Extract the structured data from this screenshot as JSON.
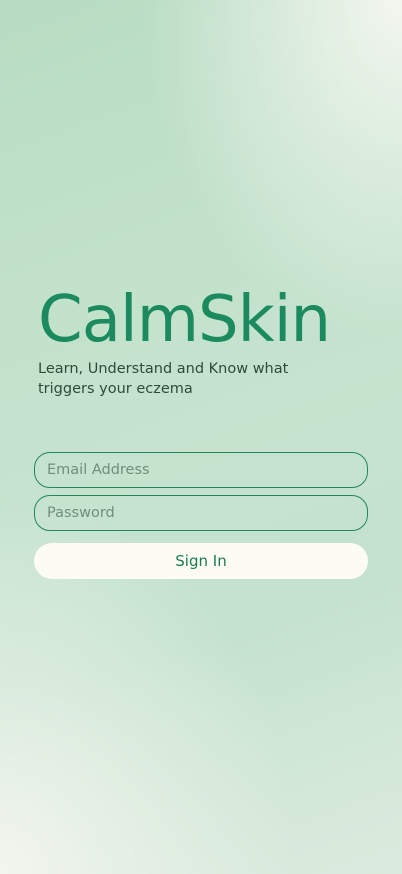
{
  "app": {
    "logo_text": "CalmSkin",
    "tagline": "Learn, Understand and Know what triggers your eczema"
  },
  "form": {
    "email_placeholder": "Email Address",
    "password_placeholder": "Password",
    "sign_in_label": "Sign In"
  },
  "colors": {
    "brand_green": "#1b8a5e",
    "button_bg": "#fdfcf2",
    "field_border": "#22875d"
  }
}
